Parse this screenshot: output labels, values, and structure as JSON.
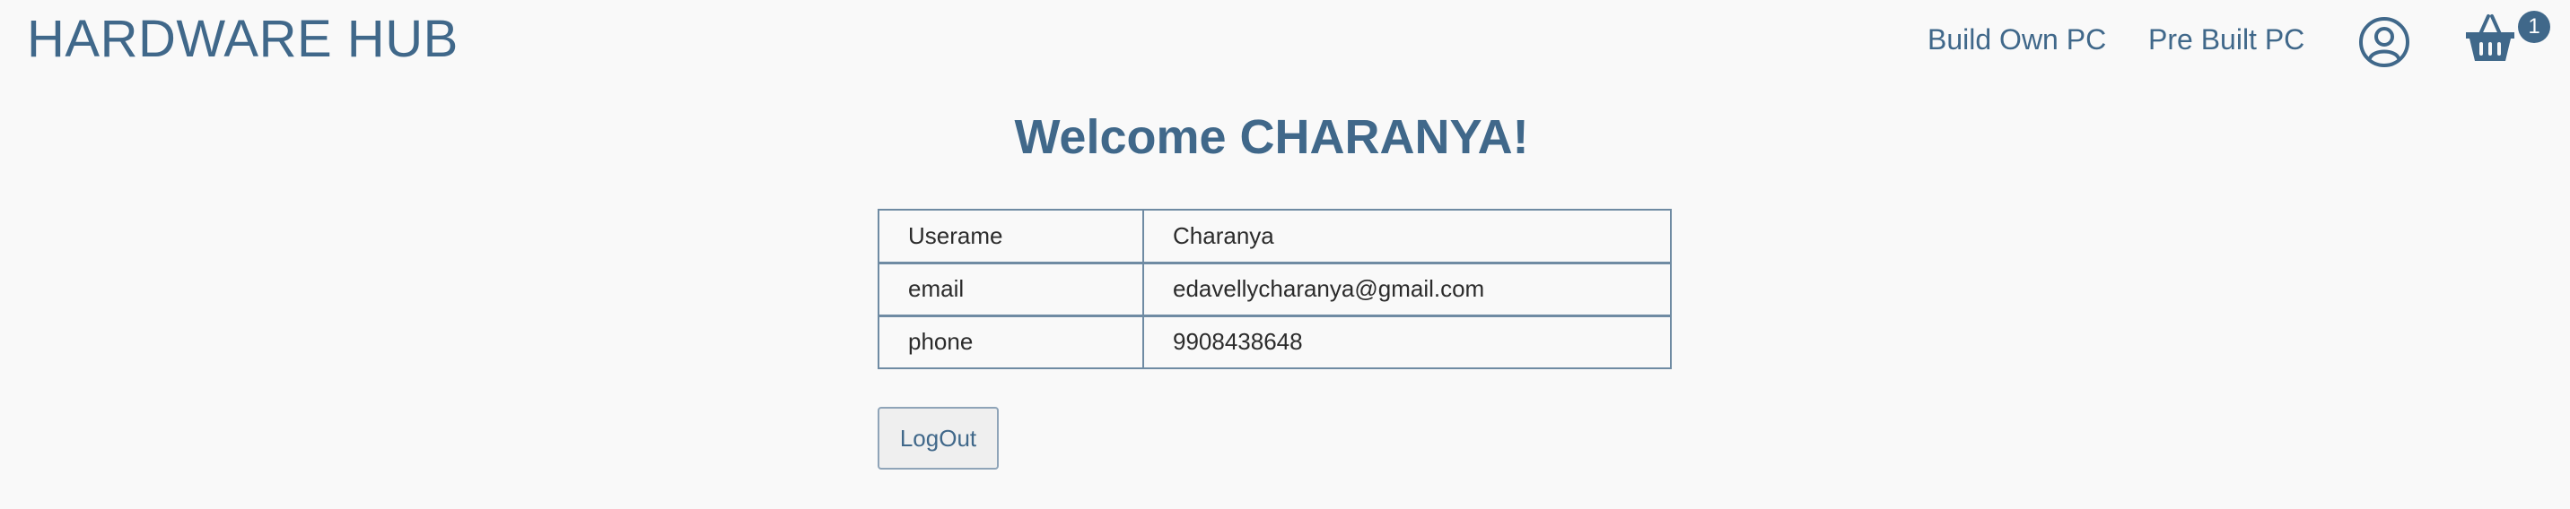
{
  "header": {
    "brand": "HARDWARE HUB",
    "nav": {
      "build_own_pc": "Build Own PC",
      "pre_built_pc": "Pre Built PC"
    },
    "icons": {
      "account": "user-circle-icon",
      "cart": "shopping-basket-icon"
    },
    "cart_count": "1"
  },
  "main": {
    "welcome": "Welcome CHARANYA!",
    "profile": [
      {
        "label": "Userame",
        "value": "Charanya"
      },
      {
        "label": "email",
        "value": "edavellycharanya@gmail.com"
      },
      {
        "label": "phone",
        "value": "9908438648"
      }
    ],
    "logout_label": "LogOut"
  },
  "colors": {
    "accent": "#40688a",
    "background": "#f9f9f9",
    "text": "#2b2b2b"
  }
}
